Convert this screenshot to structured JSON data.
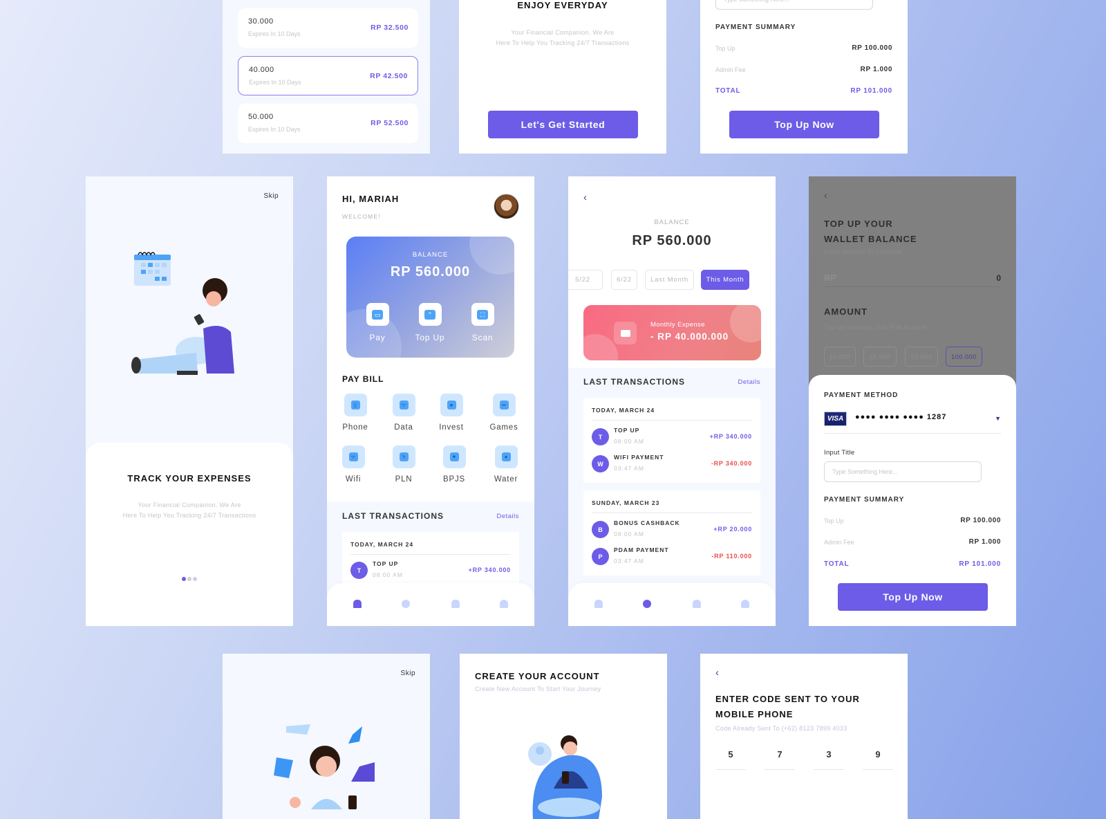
{
  "colors": {
    "accent": "#6c5ce7",
    "negative": "#ef4b4b",
    "expense_card": "#f47884",
    "balance_card": "#5a7ef5"
  },
  "packages_screen": {
    "items": [
      {
        "amount": "30.000",
        "expiry": "Expires In 10 Days",
        "price": "RP 32.500",
        "selected": false
      },
      {
        "amount": "40.000",
        "expiry": "Expires In 10 Days",
        "price": "RP 42.500",
        "selected": true
      },
      {
        "amount": "50.000",
        "expiry": "Expires In 10 Days",
        "price": "RP 52.500",
        "selected": false
      }
    ]
  },
  "enjoy_screen": {
    "title": "ENJOY EVERYDAY",
    "desc_line1": "Your Financial Companion. We Are",
    "desc_line2": "Here To Help You Tracking 24/7 Transactions",
    "button": "Let's Get Started"
  },
  "summary_top": {
    "input_placeholder": "Type Something Here...",
    "title": "PAYMENT SUMMARY",
    "rows": [
      {
        "label": "Top Up",
        "value": "RP 100.000"
      },
      {
        "label": "Admin Fee",
        "value": "RP 1.000"
      },
      {
        "label": "TOTAL",
        "value": "RP 101.000"
      }
    ],
    "button": "Top Up Now"
  },
  "track_screen": {
    "skip": "Skip",
    "illustration": "person-sitting-with-phone-and-calendar",
    "title": "TRACK YOUR EXPENSES",
    "desc_line1": "Your Financial Companion. We Are",
    "desc_line2": "Here To Help You Tracking 24/7 Transactions",
    "pager": {
      "current": 1,
      "total": 3
    }
  },
  "home_screen": {
    "greeting": "HI, MARIAH",
    "welcome": "WELCOME!",
    "balance_label": "BALANCE",
    "balance_value": "RP 560.000",
    "quick_actions": [
      {
        "label": "Pay",
        "icon": "wallet-icon"
      },
      {
        "label": "Top Up",
        "icon": "topup-icon"
      },
      {
        "label": "Scan",
        "icon": "scan-icon"
      }
    ],
    "pay_bill_title": "PAY BILL",
    "bills": [
      {
        "label": "Phone",
        "icon": "phone-icon"
      },
      {
        "label": "Data",
        "icon": "data-icon"
      },
      {
        "label": "Invest",
        "icon": "invest-icon"
      },
      {
        "label": "Games",
        "icon": "gamepad-icon"
      },
      {
        "label": "Wifi",
        "icon": "wifi-icon"
      },
      {
        "label": "PLN",
        "icon": "lightning-icon"
      },
      {
        "label": "BPJS",
        "icon": "heart-icon"
      },
      {
        "label": "Water",
        "icon": "water-drop-icon"
      }
    ],
    "last_tx_title": "LAST TRANSACTIONS",
    "details": "Details",
    "tx_date": "TODAY, MARCH 24",
    "tx": [
      {
        "initial": "T",
        "name": "TOP UP",
        "time": "08:00 AM",
        "amount": "+RP 340.000",
        "type": "credit"
      }
    ],
    "nav": [
      "home",
      "history",
      "notifications",
      "profile"
    ],
    "nav_active": "home"
  },
  "history_screen": {
    "balance_label": "BALANCE",
    "balance_value": "RP 560.000",
    "filters": [
      {
        "label": "5/22",
        "active": false
      },
      {
        "label": "6/22",
        "active": false
      },
      {
        "label": "Last Month",
        "active": false
      },
      {
        "label": "This Month",
        "active": true
      }
    ],
    "expense_label": "Monthly Expense",
    "expense_value": "- RP 40.000.000",
    "last_tx_title": "LAST TRANSACTIONS",
    "details": "Details",
    "groups": [
      {
        "date": "TODAY, MARCH 24",
        "tx": [
          {
            "initial": "T",
            "name": "TOP UP",
            "time": "08:00 AM",
            "amount": "+RP 340.000",
            "type": "credit"
          },
          {
            "initial": "W",
            "name": "WIFI PAYMENT",
            "time": "03:47 AM",
            "amount": "-RP 340.000",
            "type": "debit"
          }
        ]
      },
      {
        "date": "SUNDAY, MARCH 23",
        "tx": [
          {
            "initial": "B",
            "name": "BONUS CASHBACK",
            "time": "08:00 AM",
            "amount": "+RP 20.000",
            "type": "credit"
          },
          {
            "initial": "P",
            "name": "PDAM PAYMENT",
            "time": "03:47 AM",
            "amount": "-RP 110.000",
            "type": "debit"
          }
        ]
      }
    ],
    "nav_active": "history"
  },
  "topup_screen": {
    "title_line1": "TOP UP YOUR",
    "title_line2": "WALLET BALANCE",
    "subtitle": "Insert Amount To Continue",
    "currency": "RP",
    "amount_value": "0",
    "amount_title": "AMOUNT",
    "amount_sub": "Top Up Instantly, Just Pick Amount",
    "amount_options": [
      {
        "label": "10.000",
        "active": false
      },
      {
        "label": "25.000",
        "active": false
      },
      {
        "label": "50.000",
        "active": false
      },
      {
        "label": "100.000",
        "active": true
      }
    ],
    "payment_method_title": "PAYMENT METHOD",
    "card_brand": "VISA",
    "card_number": "●●●● ●●●● ●●●● 1287",
    "input_title": "Input Title",
    "input_placeholder": "Type Something Here...",
    "summary_title": "PAYMENT SUMMARY",
    "rows": [
      {
        "label": "Top Up",
        "value": "RP 100.000"
      },
      {
        "label": "Admin Fee",
        "value": "RP 1.000"
      },
      {
        "label": "TOTAL",
        "value": "RP 101.000"
      }
    ],
    "button": "Top Up Now"
  },
  "welcome_screen": {
    "skip": "Skip",
    "illustration": "woman-with-flying-papers"
  },
  "create_screen": {
    "title": "CREATE YOUR ACCOUNT",
    "subtitle": "Create New Account To Start Your Journey",
    "illustration": "man-on-beanbag-with-phone"
  },
  "otp_screen": {
    "title_line1": "ENTER CODE SENT TO YOUR",
    "title_line2": "MOBILE PHONE",
    "subtitle": "Code Already Sent To (+62) 8123 7899 4033",
    "digits": [
      "5",
      "7",
      "3",
      "9"
    ]
  }
}
